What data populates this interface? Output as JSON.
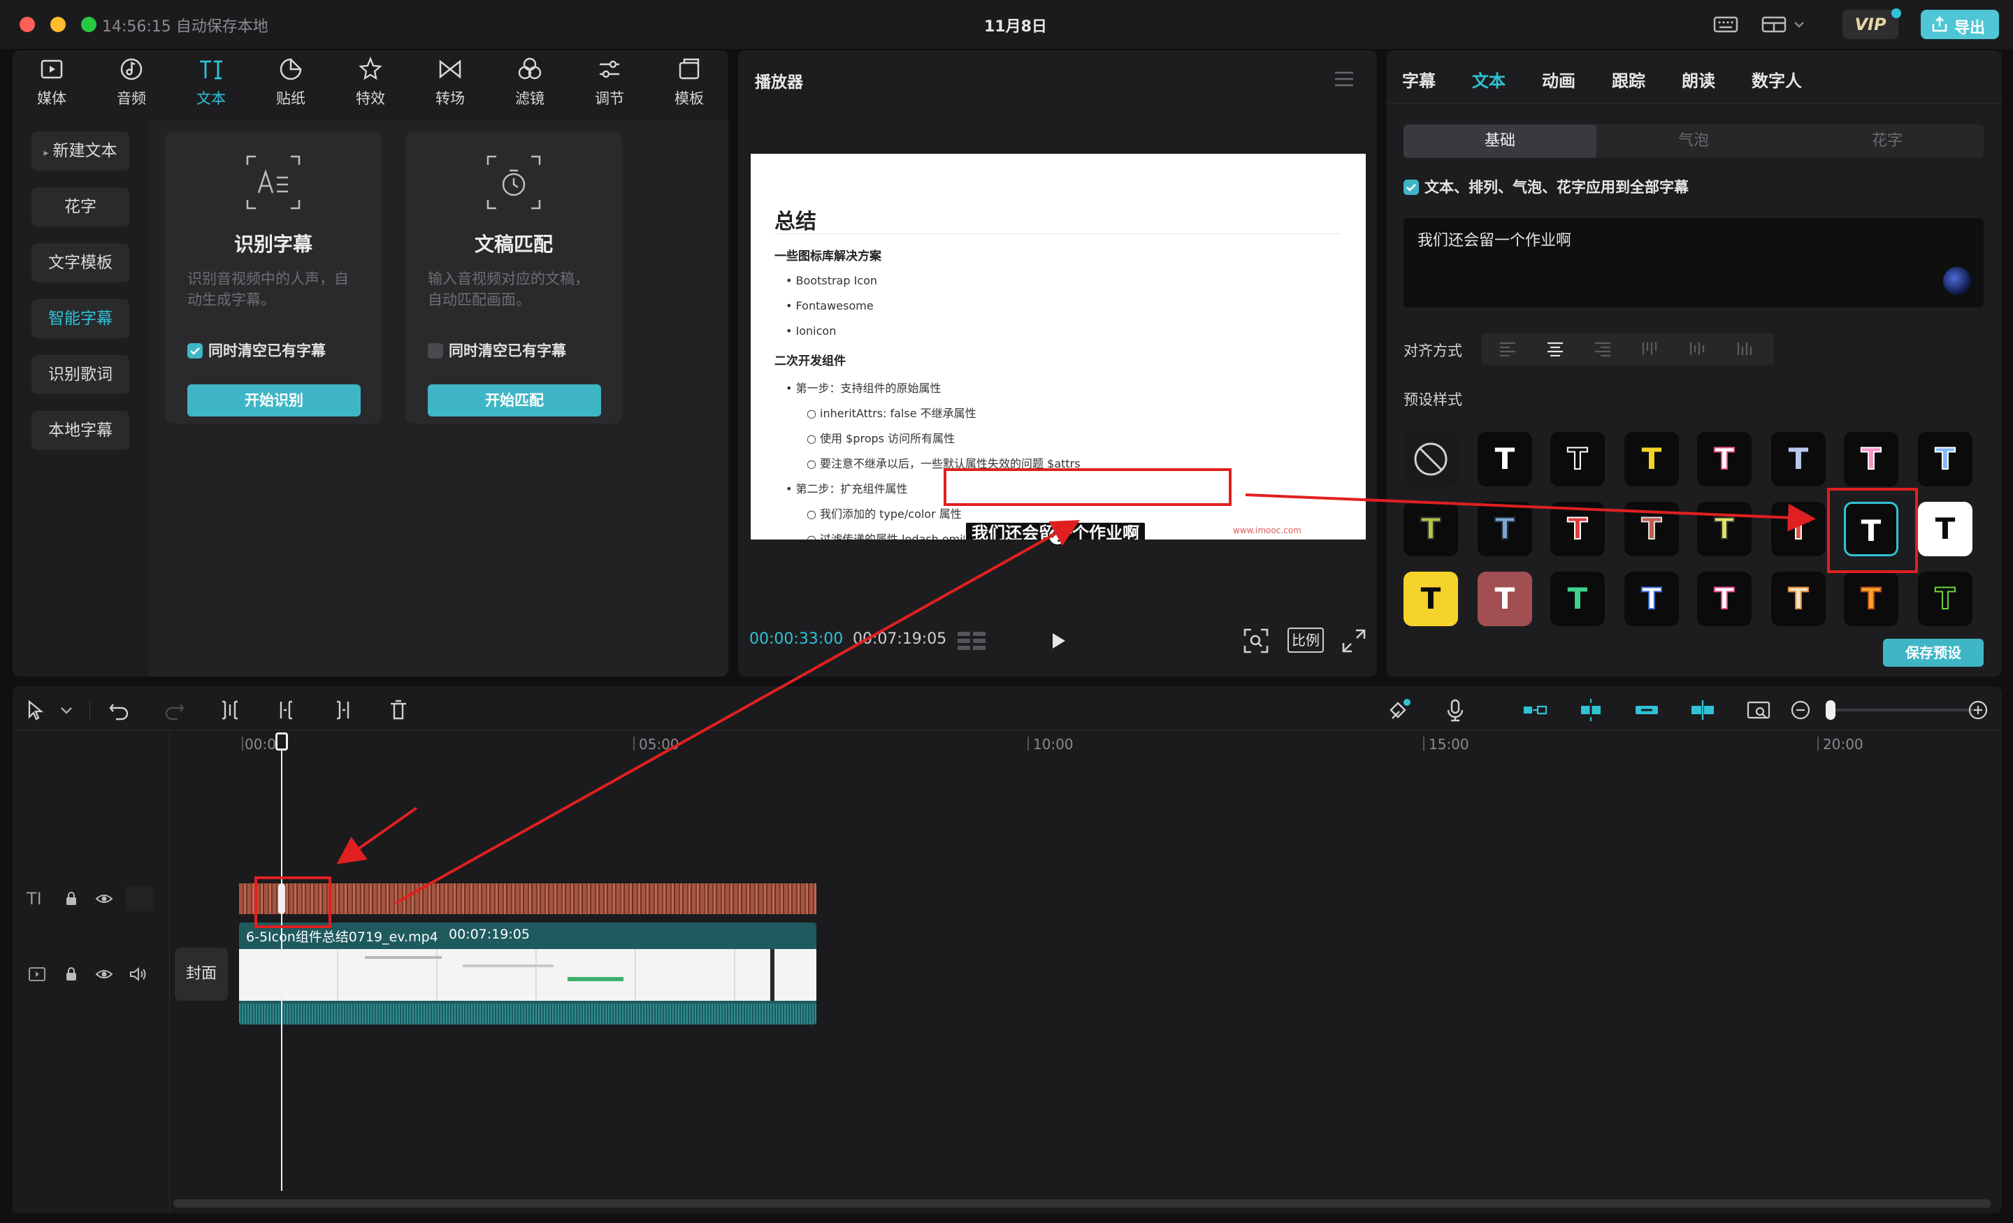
{
  "titlebar": {
    "autosave": "14:56:15 自动保存本地",
    "date": "11月8日",
    "vip": "VIP",
    "export_label": "导出"
  },
  "toolbar": {
    "items": [
      {
        "label": "媒体",
        "icon": "media-icon"
      },
      {
        "label": "音频",
        "icon": "audio-icon"
      },
      {
        "label": "文本",
        "icon": "text-icon"
      },
      {
        "label": "贴纸",
        "icon": "sticker-icon"
      },
      {
        "label": "特效",
        "icon": "effects-icon"
      },
      {
        "label": "转场",
        "icon": "transition-icon"
      },
      {
        "label": "滤镜",
        "icon": "filter-icon"
      },
      {
        "label": "调节",
        "icon": "adjust-icon"
      },
      {
        "label": "模板",
        "icon": "template-icon"
      }
    ],
    "active": "文本"
  },
  "text_sidebar": {
    "items": [
      "新建文本",
      "花字",
      "文字模板",
      "智能字幕",
      "识别歌词",
      "本地字幕"
    ],
    "active": "智能字幕"
  },
  "cards": [
    {
      "title": "识别字幕",
      "desc": "识别音视频中的人声，自动生成字幕。",
      "checkbox": "同时清空已有字幕",
      "checked": true,
      "button": "开始识别"
    },
    {
      "title": "文稿匹配",
      "desc": "输入音视频对应的文稿，自动匹配画面。",
      "checkbox": "同时清空已有字幕",
      "checked": false,
      "button": "开始匹配"
    }
  ],
  "player": {
    "title": "播放器",
    "current_time": "00:00:33:00",
    "total_time": "00:07:19:05",
    "ratio_label": "比例",
    "caption": "我们还会留一个作业啊",
    "slide": {
      "heading": "总结",
      "section1": "一些图标库解决方案",
      "bullets1": [
        "Bootstrap Icon",
        "Fontawesome",
        "Ionicon"
      ],
      "section2": "二次开发组件",
      "step1": "第一步：支持组件的原始属性",
      "sub1": [
        "inheritAttrs: false 不继承属性",
        "使用 $props 访问所有属性",
        "要注意不继承以后，一些默认属性失效的问题 $attrs"
      ],
      "step2": "第二步：扩充组件属性",
      "sub2": [
        "我们添加的 type/color 属性",
        "过滤传递的属性 lodash.omit"
      ],
      "watermark": "www.imooc.com"
    }
  },
  "inspector": {
    "tabs": [
      "字幕",
      "文本",
      "动画",
      "跟踪",
      "朗读",
      "数字人"
    ],
    "active_tab": "文本",
    "subtabs": [
      "基础",
      "气泡",
      "花字"
    ],
    "active_subtab": "基础",
    "apply_all": "文本、排列、气泡、花字应用到全部字幕",
    "text_value": "我们还会留一个作业啊",
    "align_label": "对齐方式",
    "preset_label": "预设样式",
    "save_preset": "保存预设",
    "preset_glyph": "T"
  },
  "timeline": {
    "ruler": [
      "00:00",
      "05:00",
      "10:00",
      "15:00",
      "20:00"
    ],
    "video_clip_name": "6-5Icon组件总结0719_ev.mp4",
    "video_clip_duration": "00:07:19:05",
    "cover_label": "封面"
  },
  "colors": {
    "accent": "#2fc3d5",
    "annotation_red": "#e02020",
    "subtitle_track": "#a8543f",
    "video_track": "#1e5a5e"
  }
}
